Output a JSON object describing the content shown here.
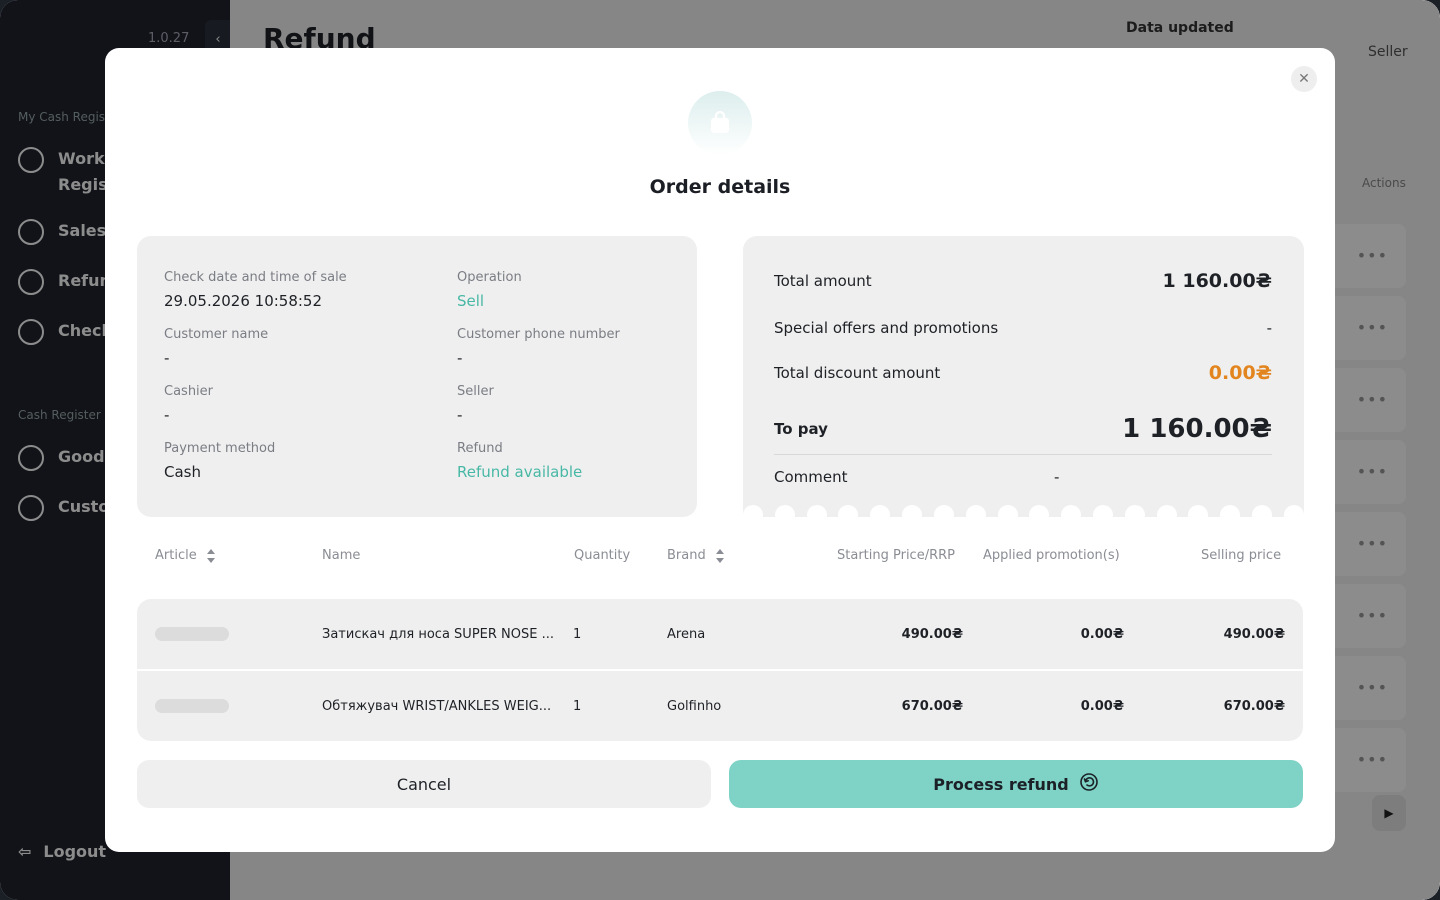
{
  "sidebar": {
    "version": "1.0.27",
    "section_my_cash": "My Cash Register",
    "items": [
      {
        "label": "Work with Cash Register"
      },
      {
        "label": "Sales"
      },
      {
        "label": "Refund"
      },
      {
        "label": "Checks"
      },
      {
        "label": "Goods"
      },
      {
        "label": "Customers"
      }
    ],
    "section_cash": "Cash Register",
    "logout": "Logout"
  },
  "main": {
    "title": "Refund",
    "data_updated": "Data updated",
    "seller_header": "Seller",
    "actions_header": "Actions"
  },
  "modal": {
    "title": "Order details",
    "info": {
      "check_date_label": "Check date and time of sale",
      "check_date_value": "29.05.2026 10:58:52",
      "operation_label": "Operation",
      "operation_value": "Sell",
      "customer_name_label": "Customer name",
      "customer_name_value": "-",
      "customer_phone_label": "Customer phone number",
      "customer_phone_value": "-",
      "cashier_label": "Cashier",
      "cashier_value": "-",
      "seller_label": "Seller",
      "seller_value": "-",
      "payment_label": "Payment method",
      "payment_value": "Cash",
      "refund_label": "Refund",
      "refund_value": "Refund available"
    },
    "summary": {
      "total_label": "Total amount",
      "total_value": "1 160.00₴",
      "offers_label": "Special offers and promotions",
      "offers_value": "-",
      "discount_label": "Total discount amount",
      "discount_value": "0.00₴",
      "topay_label": "To pay",
      "topay_value": "1 160.00₴",
      "comment_label": "Comment",
      "comment_value": "-"
    },
    "table": {
      "headers": {
        "article": "Article",
        "name": "Name",
        "quantity": "Quantity",
        "brand": "Brand",
        "starting_price": "Starting Price/RRP",
        "applied_promotions": "Applied promotion(s)",
        "selling_price": "Selling price"
      },
      "rows": [
        {
          "name": "Затискач для носа SUPER NOSE ...",
          "quantity": "1",
          "brand": "Arena",
          "starting_price": "490.00₴",
          "promotion": "0.00₴",
          "selling_price": "490.00₴"
        },
        {
          "name": "Обтяжувач WRIST/ANKLES WEIG...",
          "quantity": "1",
          "brand": "Golfinho",
          "starting_price": "670.00₴",
          "promotion": "0.00₴",
          "selling_price": "670.00₴"
        }
      ]
    },
    "buttons": {
      "cancel": "Cancel",
      "process_refund": "Process refund"
    }
  },
  "colors": {
    "accent_green": "#48b8a6",
    "refund_button": "#7fd2c6",
    "discount_orange": "#e3851e"
  }
}
